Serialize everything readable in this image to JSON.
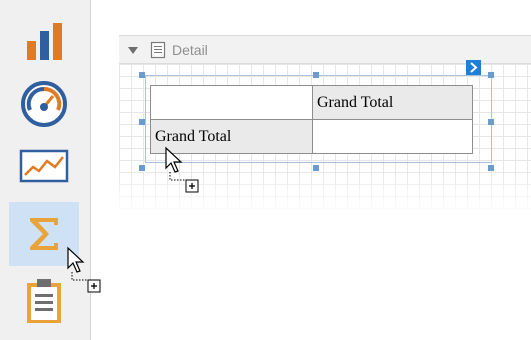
{
  "toolbox": {
    "items": [
      {
        "name": "bar-chart-icon",
        "active": false
      },
      {
        "name": "gauge-icon",
        "active": false
      },
      {
        "name": "sparkline-icon",
        "active": false
      },
      {
        "name": "pivot-grid-icon",
        "active": true
      },
      {
        "name": "clipboard-icon",
        "active": false
      }
    ]
  },
  "band": {
    "title": "Detail"
  },
  "pivot": {
    "column_header": "Grand Total",
    "row_header": "Grand Total"
  },
  "colors": {
    "accent": "#1f7fd6",
    "selection_handle": "#6b9bd1",
    "chart_orange": "#e07b24",
    "chart_blue": "#2f5f9f",
    "sigma": "#e8a33a",
    "toolbox_active": "#cfe2f5"
  }
}
